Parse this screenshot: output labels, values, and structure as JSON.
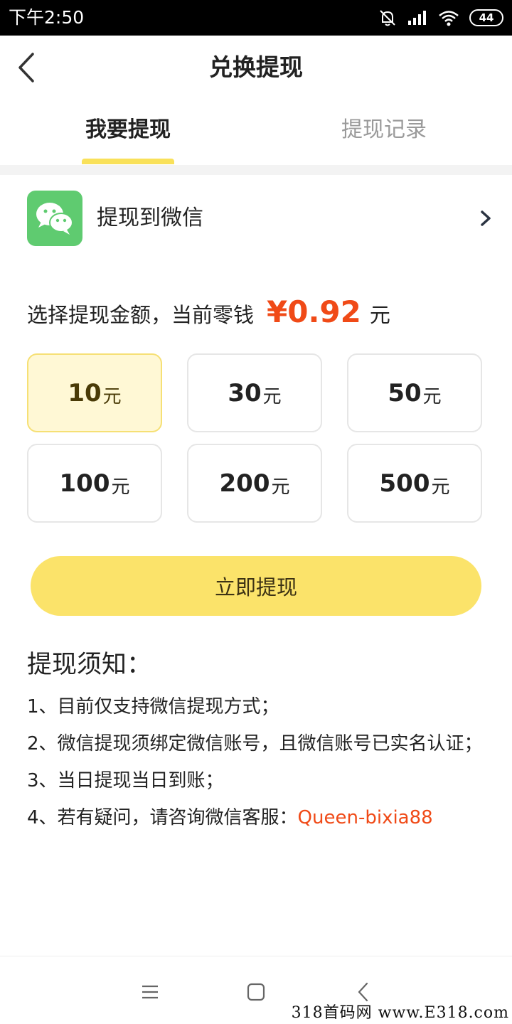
{
  "status_bar": {
    "time": "下午2:50",
    "battery": "44",
    "icons": [
      "mute-bell-icon",
      "signal-icon",
      "wifi-icon",
      "battery-icon"
    ]
  },
  "header": {
    "title": "兑换提现",
    "back_icon": "chevron-left-icon"
  },
  "tabs": [
    {
      "label": "我要提现",
      "active": true
    },
    {
      "label": "提现记录",
      "active": false
    }
  ],
  "payout": {
    "label": "提现到微信",
    "icon": "wechat-icon"
  },
  "balance": {
    "label": "选择提现金额，当前零钱",
    "amount": "¥0.92",
    "unit": "元"
  },
  "amounts": [
    {
      "value": "10",
      "unit": "元",
      "selected": true
    },
    {
      "value": "30",
      "unit": "元",
      "selected": false
    },
    {
      "value": "50",
      "unit": "元",
      "selected": false
    },
    {
      "value": "100",
      "unit": "元",
      "selected": false
    },
    {
      "value": "200",
      "unit": "元",
      "selected": false
    },
    {
      "value": "500",
      "unit": "元",
      "selected": false
    }
  ],
  "action": {
    "label": "立即提现"
  },
  "notice": {
    "title": "提现须知：",
    "items": [
      "1、目前仅支持微信提现方式；",
      "2、微信提现须绑定微信账号，且微信账号已实名认证；",
      "3、当日提现当日到账；"
    ],
    "contact_prefix": "4、若有疑问，请咨询微信客服：",
    "contact_id": "Queen-bixia88"
  },
  "colors": {
    "accent_yellow": "#fbe36a",
    "selected_bg": "#fff8d5",
    "highlight_orange": "#f04a17",
    "wechat_green": "#5fcb70"
  },
  "watermark": "318首码网  www.E318.com"
}
